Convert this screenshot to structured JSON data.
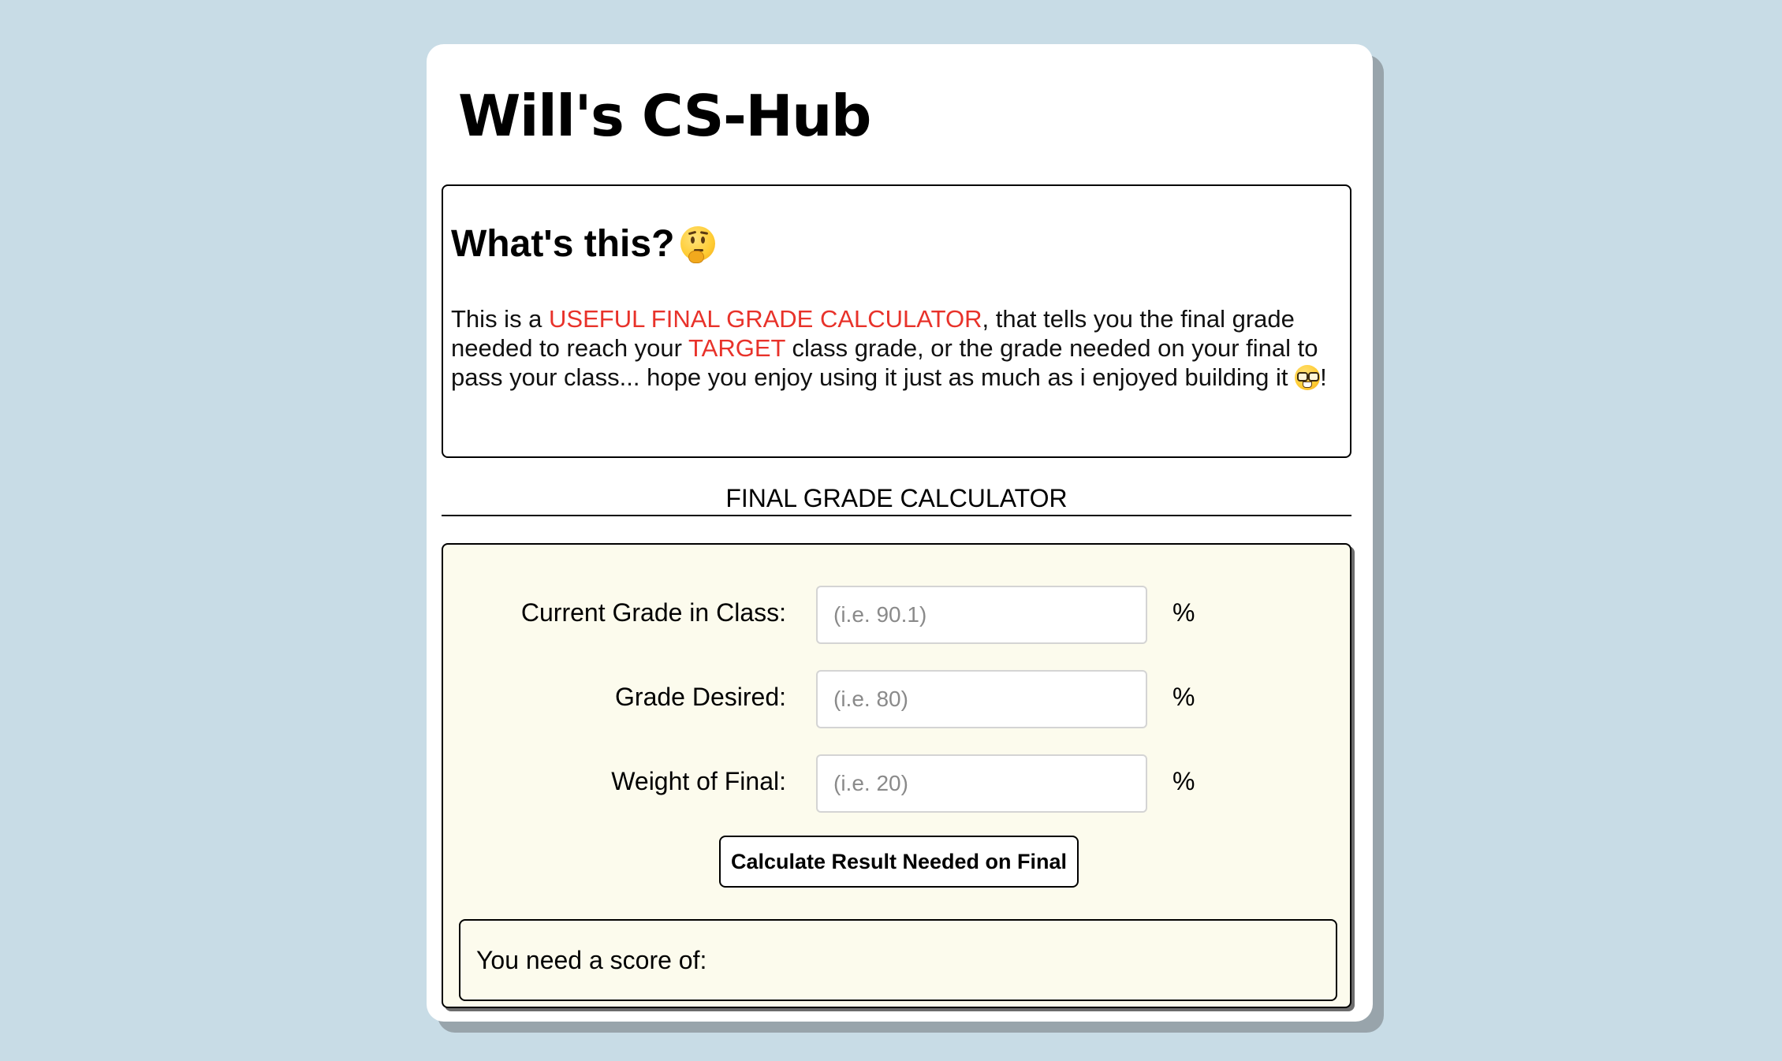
{
  "site": {
    "title": "Will's CS-Hub"
  },
  "info": {
    "heading": "What's this?",
    "heading_emoji": "thinking-face",
    "text_before_1": "This is a ",
    "highlight_1": "USEFUL FINAL GRADE CALCULATOR",
    "text_between": ", that tells you the final grade needed to reach your ",
    "highlight_2": "TARGET",
    "text_after": " class grade, or the grade needed on your final to pass your class... hope you enjoy using it just as much as i enjoyed building it ",
    "trailing_emoji": "nerd-face",
    "text_end": "!"
  },
  "calculator": {
    "title": "FINAL GRADE CALCULATOR",
    "fields": [
      {
        "label": "Current Grade in Class:",
        "placeholder": "(i.e. 90.1)",
        "value": "",
        "unit": "%"
      },
      {
        "label": "Grade Desired:",
        "placeholder": "(i.e. 80)",
        "value": "",
        "unit": "%"
      },
      {
        "label": "Weight of Final:",
        "placeholder": "(i.e. 20)",
        "value": "",
        "unit": "%"
      }
    ],
    "button_label": "Calculate Result Needed on Final",
    "result_label": "You need a score of:"
  },
  "colors": {
    "page_background": "#c8dce6",
    "highlight": "#e8322a",
    "calculator_background": "#fcfbed"
  }
}
